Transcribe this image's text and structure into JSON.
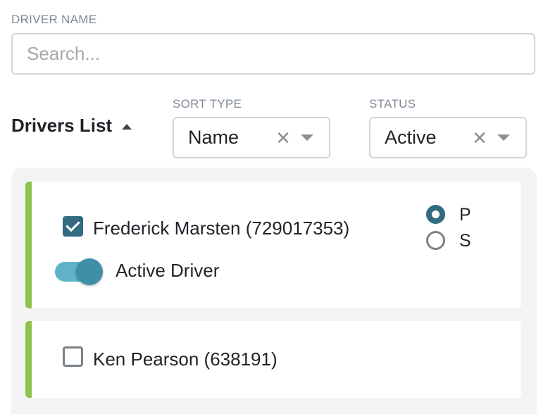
{
  "driver_name_filter": {
    "label": "DRIVER NAME",
    "placeholder": "Search...",
    "value": ""
  },
  "list_header": {
    "title": "Drivers List",
    "sort_direction": "ascending"
  },
  "sort_type": {
    "label": "SORT TYPE",
    "value": "Name",
    "clear_glyph": "✕"
  },
  "status": {
    "label": "STATUS",
    "value": "Active",
    "clear_glyph": "✕"
  },
  "colors": {
    "accent_bar": "#8fc24d",
    "primary": "#336c80",
    "toggle_track": "#5fb3c8"
  },
  "drivers": [
    {
      "name": "Frederick Marsten (729017353)",
      "checked": true,
      "toggle_label": "Active Driver",
      "toggle_on": true,
      "radio_options": [
        {
          "label": "P",
          "selected": true
        },
        {
          "label": "S",
          "selected": false
        }
      ]
    },
    {
      "name": "Ken Pearson (638191)",
      "checked": false
    }
  ]
}
